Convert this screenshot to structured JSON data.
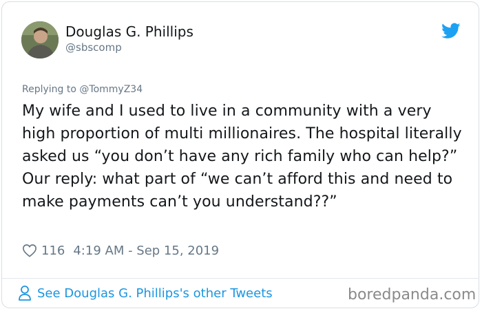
{
  "author": {
    "name": "Douglas G. Phillips",
    "handle": "@sbscomp"
  },
  "reply": {
    "prefix": "Replying to ",
    "mention": "@TommyZ34"
  },
  "tweet": {
    "text": "My wife and I used to live in a community with a very high proportion of multi millionaires. The hospital literally asked us “you don’t have any rich family who can help?” Our reply: what part of “we can’t afford this and need to make payments can’t you understand??”"
  },
  "meta": {
    "likes": "116",
    "timestamp": "4:19 AM - Sep 15, 2019"
  },
  "footer": {
    "link_text": "See Douglas G. Phillips's other Tweets"
  },
  "watermark": "boredpanda.com",
  "colors": {
    "text": "#14171a",
    "secondary": "#657786",
    "link": "#1b95e0",
    "twitter_blue": "#1da1f2"
  },
  "icons": [
    "twitter-bird-icon",
    "heart-icon",
    "person-icon"
  ]
}
